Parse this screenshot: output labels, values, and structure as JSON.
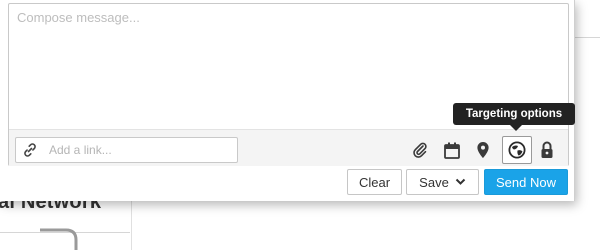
{
  "composer": {
    "message_placeholder": "Compose message...",
    "link_placeholder": "Add a link...",
    "toolbar": {
      "icons": [
        "attachment-icon",
        "calendar-icon",
        "location-pin-icon",
        "targeting-icon",
        "lock-icon"
      ],
      "active_icon": "targeting-icon",
      "tooltip": "Targeting options"
    },
    "buttons": {
      "clear_label": "Clear",
      "save_label": "Save",
      "send_label": "Send Now"
    },
    "colors": {
      "send_button": "#1aa3e8",
      "tooltip_bg": "#222222"
    }
  },
  "background": {
    "heading": "al Network"
  }
}
